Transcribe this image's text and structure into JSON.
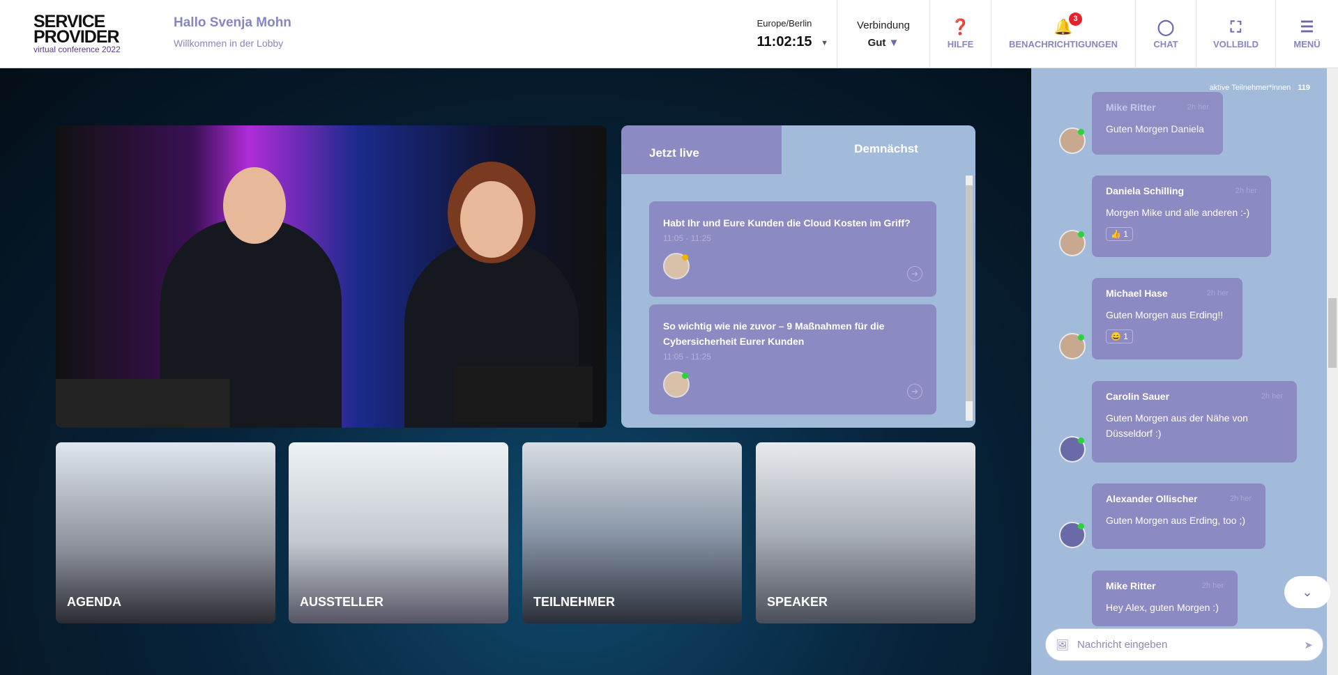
{
  "header": {
    "logo_line1": "SERVICE",
    "logo_line2": "PROVIDER",
    "logo_sub": "virtual conference 2022",
    "greeting": "Hallo Svenja Mohn",
    "subtitle": "Willkommen in der Lobby",
    "timezone": "Europe/Berlin",
    "time": "11:02:15",
    "connection_label": "Verbindung",
    "connection_value": "Gut",
    "nav": [
      {
        "label": "HILFE",
        "icon": "help-icon"
      },
      {
        "label": "BENACHRICHTIGUNGEN",
        "icon": "bell-icon",
        "badge": "3"
      },
      {
        "label": "CHAT",
        "icon": "chat-icon"
      },
      {
        "label": "VOLLBILD",
        "icon": "fullscreen-icon"
      },
      {
        "label": "MENÜ",
        "icon": "menu-icon"
      }
    ]
  },
  "sessions": {
    "tab_live": "Jetzt live",
    "tab_soon": "Demnächst",
    "items": [
      {
        "title": "Habt Ihr und Eure Kunden die Cloud Kosten im Griff?",
        "time": "11:05 - 11:25"
      },
      {
        "title": "So wichtig wie nie zuvor – 9 Maßnahmen für die Cybersicherheit Eurer Kunden",
        "time": "11:05 - 11:25"
      }
    ]
  },
  "tiles": [
    "AGENDA",
    "AUSSTELLER",
    "TEILNEHMER",
    "SPEAKER"
  ],
  "chat": {
    "active_label": "aktive Teilnehmer*innen",
    "active_count": "119",
    "placeholder": "Nachricht eingeben",
    "messages": [
      {
        "name": "Mike Ritter",
        "time": "2h her",
        "text": "Guten Morgen Daniela"
      },
      {
        "name": "Daniela Schilling",
        "time": "2h her",
        "text": "Morgen Mike und alle anderen :-)",
        "reaction": "👍 1"
      },
      {
        "name": "Michael Hase",
        "time": "2h her",
        "text": "Guten Morgen aus Erding!!",
        "reaction": "😄 1"
      },
      {
        "name": "Carolin Sauer",
        "time": "2h her",
        "text": "Guten Morgen aus der Nähe von Düsseldorf :)"
      },
      {
        "name": "Alexander Ollischer",
        "time": "2h her",
        "text": "Guten Morgen aus Erding, too ;)"
      },
      {
        "name": "Mike Ritter",
        "time": "2h her",
        "text": "Hey Alex, guten Morgen :)"
      }
    ]
  }
}
